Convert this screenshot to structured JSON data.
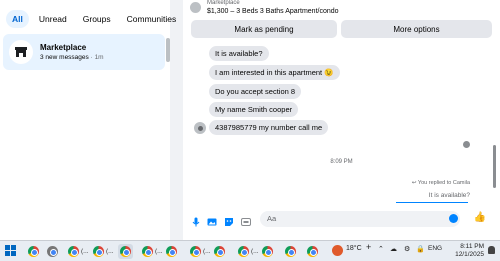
{
  "filters": [
    "All",
    "Unread",
    "Groups",
    "Communities"
  ],
  "conversation": {
    "title": "Marketplace",
    "subtitle": "3 new messages",
    "time": "· 1m"
  },
  "chat_header": {
    "small_label": "Marketplace",
    "title": "$1,300 – 3 Beds 3 Baths Apartment/condo"
  },
  "actions": {
    "pending": "Mark as pending",
    "more": "More options"
  },
  "messages": [
    "It is available?",
    "I am interested in this apartment 😉",
    "Do you accept section 8",
    "My name Smith cooper",
    "4387985779 my number call me"
  ],
  "timestamp": "8:09 PM",
  "replied_label": "You replied to Camila",
  "reply_quote": "It is available?",
  "composer": {
    "placeholder": "Aa"
  },
  "taskbar": {
    "apps": [
      "(...",
      "(...",
      "(...",
      "(...",
      "(..."
    ],
    "temperature": "18°C",
    "language": "ENG",
    "time": "8:11 PM",
    "date": "12/1/2025"
  },
  "colors": {
    "accent": "#0084ff",
    "bubble": "#e4e6eb",
    "active_chip": "#e7f3ff"
  }
}
